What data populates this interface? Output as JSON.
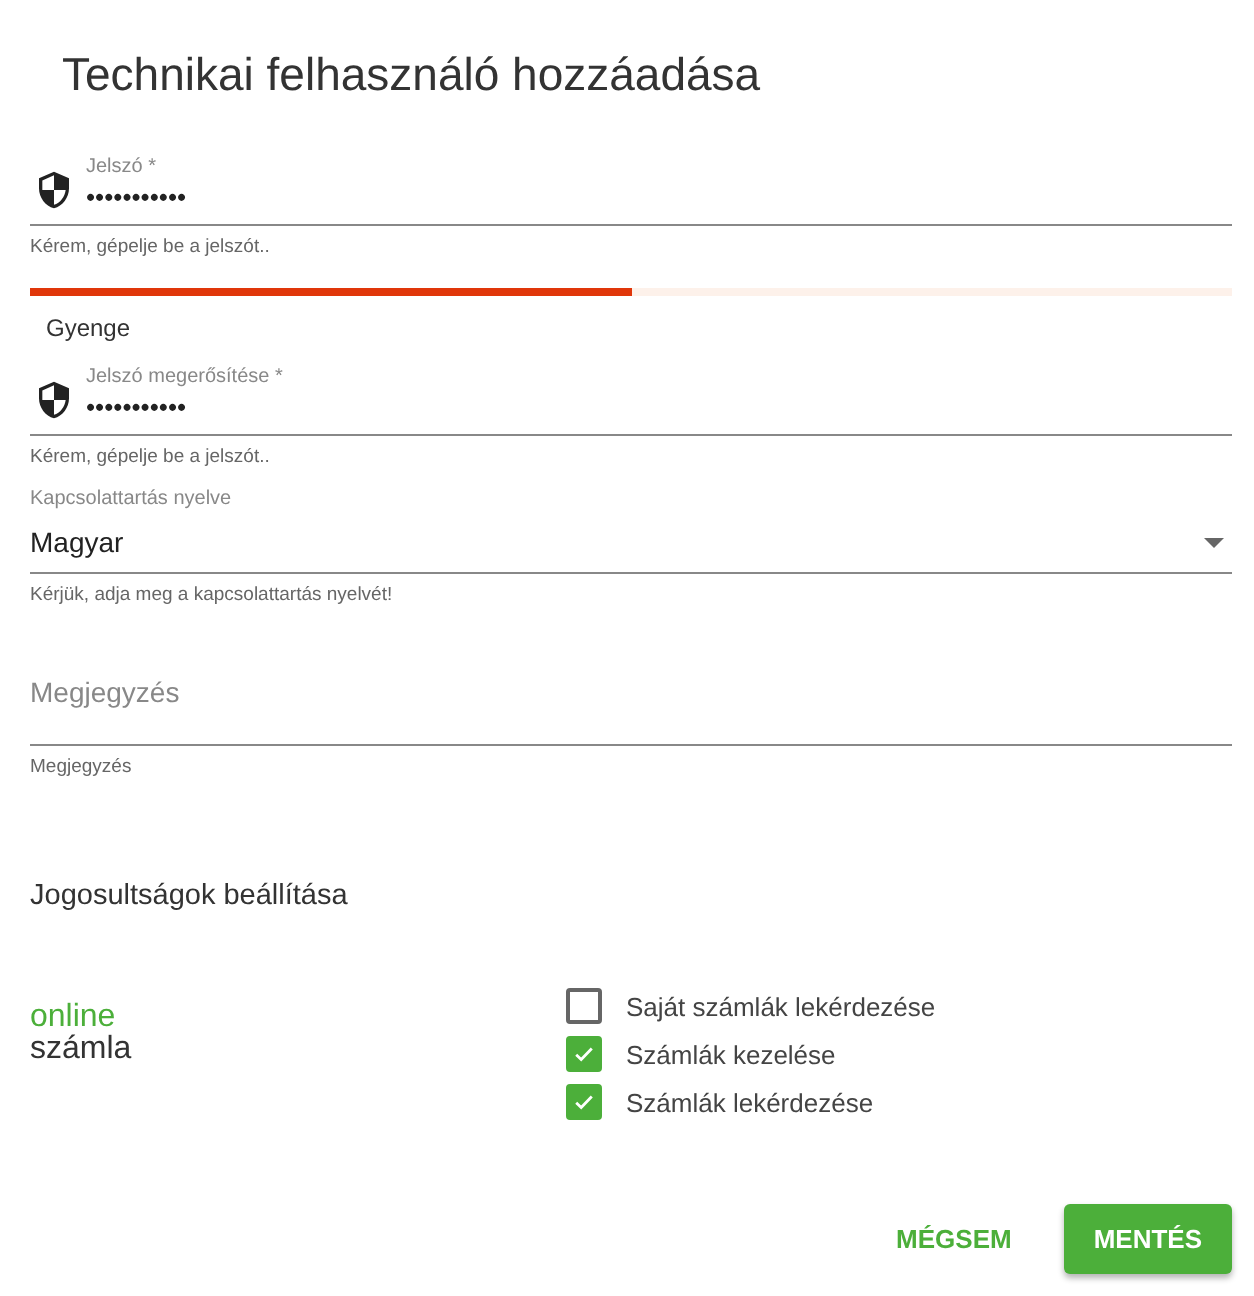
{
  "dialog": {
    "title": "Technikai felhasználó hozzáadása"
  },
  "password": {
    "label": "Jelszó *",
    "value": "•••••••••••",
    "hint": "Kérem, gépelje be a jelszót..",
    "strength": {
      "level": 0.5,
      "label": "Gyenge"
    }
  },
  "password_confirm": {
    "label": "Jelszó megerősítése *",
    "value": "•••••••••••",
    "hint": "Kérem, gépelje be a jelszót.."
  },
  "language": {
    "label": "Kapcsolattartás nyelve",
    "value": "Magyar",
    "hint": "Kérjük, adja meg a kapcsolattartás nyelvét!"
  },
  "note": {
    "placeholder": "Megjegyzés",
    "hint": "Megjegyzés"
  },
  "permissions": {
    "title": "Jogosultságok beállítása",
    "logo": {
      "top": "online",
      "bottom": "számla"
    },
    "items": [
      {
        "label": "Saját számlák lekérdezése",
        "checked": false
      },
      {
        "label": "Számlák kezelése",
        "checked": true
      },
      {
        "label": "Számlák lekérdezése",
        "checked": true
      }
    ]
  },
  "buttons": [
    {
      "label": "MÉGSEM",
      "kind": "text"
    },
    {
      "label": "MENTÉS",
      "kind": "raised"
    }
  ]
}
